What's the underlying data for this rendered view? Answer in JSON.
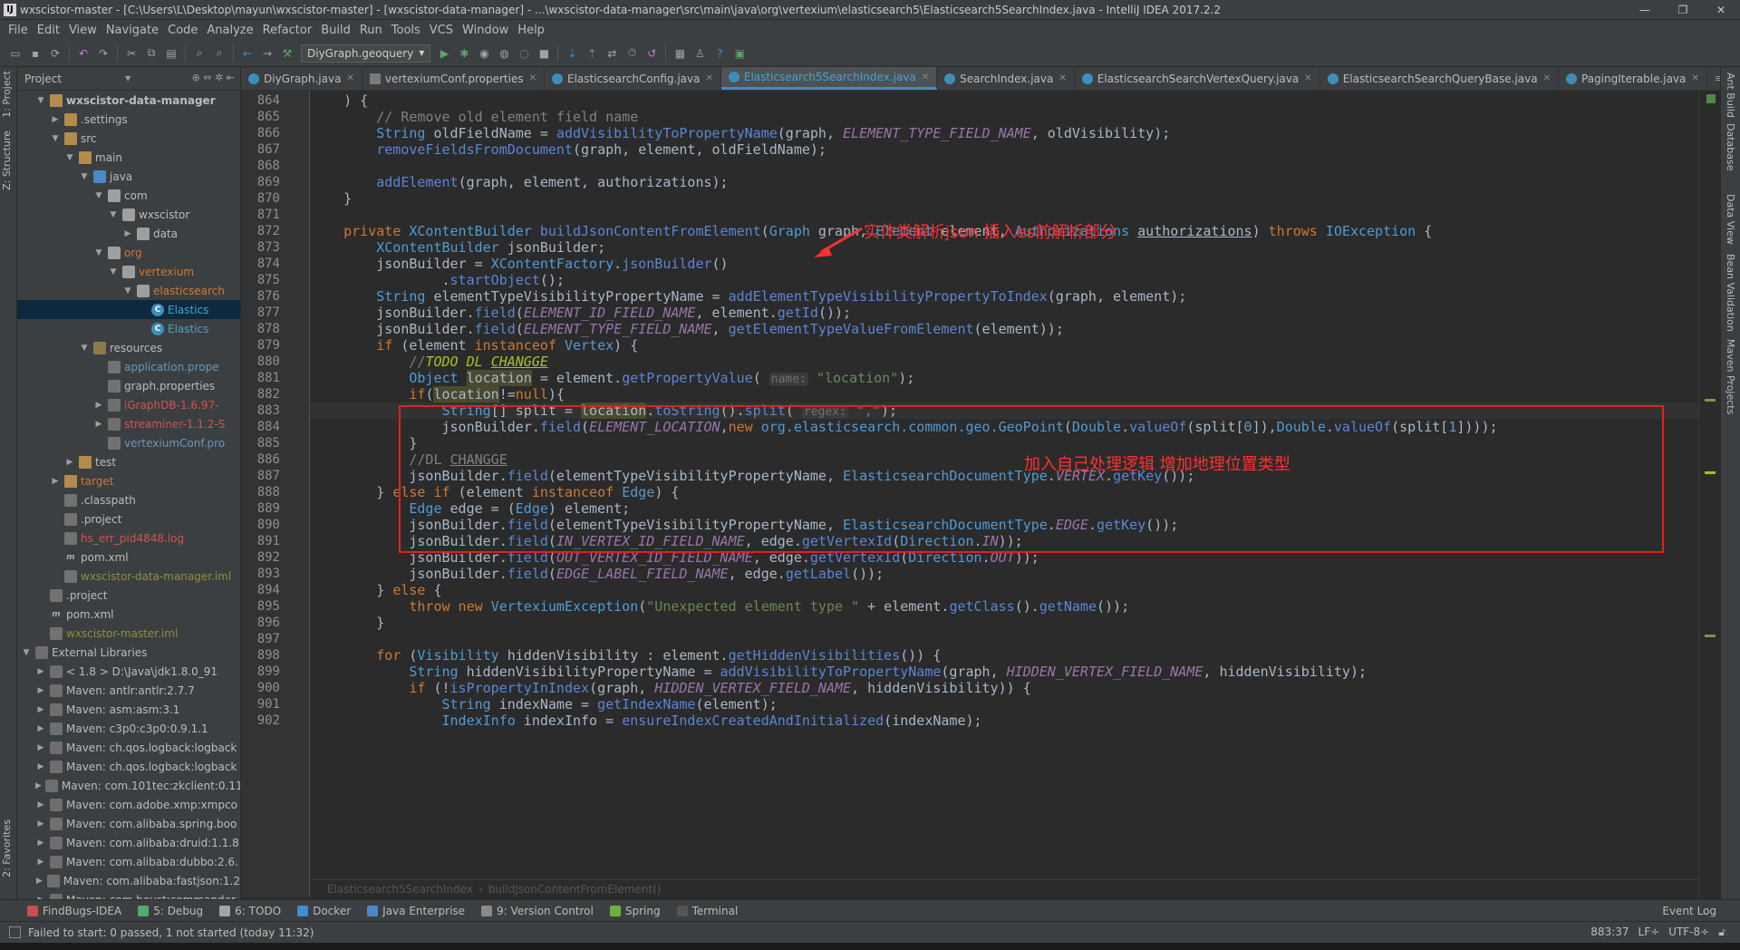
{
  "window": {
    "title": "wxscistor-master - [C:\\Users\\L\\Desktop\\mayun\\wxscistor-master] - [wxscistor-data-manager] - ...\\wxscistor-data-manager\\src\\main\\java\\org\\vertexium\\elasticsearch5\\Elasticsearch5SearchIndex.java - IntelliJ IDEA 2017.2.2",
    "app_icon": "IJ",
    "minimize": "—",
    "maximize": "❐",
    "close": "✕"
  },
  "menu": [
    "File",
    "Edit",
    "View",
    "Navigate",
    "Code",
    "Analyze",
    "Refactor",
    "Build",
    "Run",
    "Tools",
    "VCS",
    "Window",
    "Help"
  ],
  "toolbar": {
    "run_config": "DiyGraph.geoquery"
  },
  "sidebar_left": {
    "project_tab": "1: Project",
    "structure_tab": "Z: Structure",
    "favorites_tab": "2: Favorites"
  },
  "sidebar_right": {
    "tabs": [
      "Ant Build",
      "Database",
      "Data View",
      "Bean Validation",
      "Maven Projects"
    ]
  },
  "project_panel": {
    "title": "Project",
    "tree": [
      {
        "label": "wxscistor-data-manager",
        "indent": 1,
        "arrow": "▼",
        "icon": "folder",
        "style": "bold"
      },
      {
        "label": ".settings",
        "indent": 2,
        "arrow": "▶",
        "icon": "folder"
      },
      {
        "label": "src",
        "indent": 2,
        "arrow": "▼",
        "icon": "folder"
      },
      {
        "label": "main",
        "indent": 3,
        "arrow": "▼",
        "icon": "folder"
      },
      {
        "label": "java",
        "indent": 4,
        "arrow": "▼",
        "icon": "src"
      },
      {
        "label": "com",
        "indent": 5,
        "arrow": "▼",
        "icon": "pkg"
      },
      {
        "label": "wxscistor",
        "indent": 6,
        "arrow": "▼",
        "icon": "pkg"
      },
      {
        "label": "data",
        "indent": 7,
        "arrow": "▶",
        "icon": "pkg"
      },
      {
        "label": "org",
        "indent": 5,
        "arrow": "▼",
        "icon": "pkg",
        "color": "orange"
      },
      {
        "label": "vertexium",
        "indent": 6,
        "arrow": "▼",
        "icon": "pkg",
        "color": "orange"
      },
      {
        "label": "elasticsearch",
        "indent": 7,
        "arrow": "▼",
        "icon": "pkg",
        "color": "orange"
      },
      {
        "label": "Elastics",
        "indent": 8,
        "arrow": "",
        "icon": "class",
        "color": "cyan",
        "selected": true
      },
      {
        "label": "Elastics",
        "indent": 8,
        "arrow": "",
        "icon": "class",
        "color": "cyan"
      },
      {
        "label": "resources",
        "indent": 4,
        "arrow": "▼",
        "icon": "res"
      },
      {
        "label": "application.prope",
        "indent": 5,
        "arrow": "",
        "icon": "file",
        "color": "blue"
      },
      {
        "label": "graph.properties",
        "indent": 5,
        "arrow": "",
        "icon": "file"
      },
      {
        "label": "iGraphDB-1.6.97-",
        "indent": 5,
        "arrow": "▶",
        "icon": "lib",
        "color": "red"
      },
      {
        "label": "streaminer-1.1.2-S",
        "indent": 5,
        "arrow": "▶",
        "icon": "lib",
        "color": "red"
      },
      {
        "label": "vertexiumConf.pro",
        "indent": 5,
        "arrow": "",
        "icon": "file",
        "color": "blue"
      },
      {
        "label": "test",
        "indent": 3,
        "arrow": "▶",
        "icon": "folder"
      },
      {
        "label": "target",
        "indent": 2,
        "arrow": "▶",
        "icon": "folder",
        "color": "orange"
      },
      {
        "label": ".classpath",
        "indent": 2,
        "arrow": "",
        "icon": "file"
      },
      {
        "label": ".project",
        "indent": 2,
        "arrow": "",
        "icon": "file"
      },
      {
        "label": "hs_err_pid4848.log",
        "indent": 2,
        "arrow": "",
        "icon": "file",
        "color": "red"
      },
      {
        "label": "pom.xml",
        "indent": 2,
        "arrow": "",
        "icon": "m"
      },
      {
        "label": "wxscistor-data-manager.iml",
        "indent": 2,
        "arrow": "",
        "icon": "file",
        "color": "olive"
      },
      {
        "label": ".project",
        "indent": 1,
        "arrow": "",
        "icon": "file"
      },
      {
        "label": "pom.xml",
        "indent": 1,
        "arrow": "",
        "icon": "m"
      },
      {
        "label": "wxscistor-master.iml",
        "indent": 1,
        "arrow": "",
        "icon": "file",
        "color": "olive"
      },
      {
        "label": "External Libraries",
        "indent": 0,
        "arrow": "▼",
        "icon": "lib"
      },
      {
        "label": "< 1.8 >  D:\\Java\\jdk1.8.0_91",
        "indent": 1,
        "arrow": "▶",
        "icon": "lib"
      },
      {
        "label": "Maven: antlr:antlr:2.7.7",
        "indent": 1,
        "arrow": "▶",
        "icon": "lib"
      },
      {
        "label": "Maven: asm:asm:3.1",
        "indent": 1,
        "arrow": "▶",
        "icon": "lib"
      },
      {
        "label": "Maven: c3p0:c3p0:0.9.1.1",
        "indent": 1,
        "arrow": "▶",
        "icon": "lib"
      },
      {
        "label": "Maven: ch.qos.logback:logback",
        "indent": 1,
        "arrow": "▶",
        "icon": "lib"
      },
      {
        "label": "Maven: ch.qos.logback:logback",
        "indent": 1,
        "arrow": "▶",
        "icon": "lib"
      },
      {
        "label": "Maven: com.101tec:zkclient:0.11",
        "indent": 1,
        "arrow": "▶",
        "icon": "lib"
      },
      {
        "label": "Maven: com.adobe.xmp:xmpco",
        "indent": 1,
        "arrow": "▶",
        "icon": "lib"
      },
      {
        "label": "Maven: com.alibaba.spring.boo",
        "indent": 1,
        "arrow": "▶",
        "icon": "lib"
      },
      {
        "label": "Maven: com.alibaba:druid:1.1.8",
        "indent": 1,
        "arrow": "▶",
        "icon": "lib"
      },
      {
        "label": "Maven: com.alibaba:dubbo:2.6.",
        "indent": 1,
        "arrow": "▶",
        "icon": "lib"
      },
      {
        "label": "Maven: com.alibaba:fastjson:1.2",
        "indent": 1,
        "arrow": "▶",
        "icon": "lib"
      },
      {
        "label": "Maven: com.beust:commander",
        "indent": 1,
        "arrow": "▶",
        "icon": "lib"
      }
    ]
  },
  "editor_tabs": [
    {
      "label": "DiyGraph.java",
      "kind": "class"
    },
    {
      "label": "vertexiumConf.properties",
      "kind": "file"
    },
    {
      "label": "ElasticsearchConfig.java",
      "kind": "class"
    },
    {
      "label": "Elasticsearch5SearchIndex.java",
      "kind": "class",
      "active": true
    },
    {
      "label": "SearchIndex.java",
      "kind": "class"
    },
    {
      "label": "ElasticsearchSearchVertexQuery.java",
      "kind": "class"
    },
    {
      "label": "ElasticsearchSearchQueryBase.java",
      "kind": "class"
    },
    {
      "label": "PagingIterable.java",
      "kind": "class"
    }
  ],
  "editor_tabs_more": "≡2",
  "code_lines": [
    {
      "n": "864",
      "html": "    ) {"
    },
    {
      "n": "865",
      "html": "        <span class='c'>// Remove old element field name</span>"
    },
    {
      "n": "866",
      "html": "        <span class='cls'>String</span> oldFieldName = <span class='m'>addVisibilityToPropertyName</span>(graph, <span class='f'>ELEMENT_TYPE_FIELD_NAME</span>, oldVisibility);"
    },
    {
      "n": "867",
      "html": "        <span class='m'>removeFieldsFromDocument</span>(graph, element, oldFieldName);"
    },
    {
      "n": "868",
      "html": ""
    },
    {
      "n": "869",
      "html": "        <span class='m'>addElement</span>(graph, element, authorizations);"
    },
    {
      "n": "870",
      "html": "    }"
    },
    {
      "n": "871",
      "html": ""
    },
    {
      "n": "872",
      "html": "    <span class='k'>private</span> <span class='cls'>XContentBuilder</span> <span class='m'>buildJsonContentFromElement</span>(<span class='cls'>Graph</span> graph, <span class='cls'>Element</span> element, <span class='cls'>Authorizations</span> <u>authorizations</u>) <span class='k'>throws</span> <span class='cls'>IOException</span> {"
    },
    {
      "n": "873",
      "html": "        <span class='cls'>XContentBuilder</span> jsonBuilder;"
    },
    {
      "n": "874",
      "html": "        jsonBuilder = <span class='cls'>XContentFactory</span>.<span class='m'>jsonBuilder</span>()"
    },
    {
      "n": "875",
      "html": "                .<span class='m'>startObject</span>();"
    },
    {
      "n": "876",
      "html": "        <span class='cls'>String</span> elementTypeVisibilityPropertyName = <span class='m'>addElementTypeVisibilityPropertyToIndex</span>(graph, element);"
    },
    {
      "n": "877",
      "html": "        jsonBuilder.<span class='m'>field</span>(<span class='f'>ELEMENT_ID_FIELD_NAME</span>, element.<span class='m'>getId</span>());"
    },
    {
      "n": "878",
      "html": "        jsonBuilder.<span class='m'>field</span>(<span class='f'>ELEMENT_TYPE_FIELD_NAME</span>, <span class='m'>getElementTypeValueFromElement</span>(element));"
    },
    {
      "n": "879",
      "html": "        <span class='k'>if</span> (element <span class='k'>instanceof</span> <span class='cls'>Vertex</span>) {"
    },
    {
      "n": "880",
      "html": "            <span class='c'>//</span><span class='todo'>TODO DL <u>CHANGGE</u></span>"
    },
    {
      "n": "881",
      "html": "            <span class='cls'>Object</span> <span class='hl'>location</span> = element.<span class='m'>getPropertyValue</span>( <span class='hint'>name:</span> <span class='s'>\"location\"</span>);"
    },
    {
      "n": "882",
      "html": "            <span class='k'>if</span>(<span class='hl'>location</span>!=<span class='k'>null</span>){"
    },
    {
      "n": "883",
      "html": "                <span class='cls'>String</span>[] split = <span class='hl'>location</span>.<span class='m'>toString</span>().<span class='m'>split</span>( <span class='hint'>regex:</span> <span class='s'>\",\"</span>);",
      "caret": true
    },
    {
      "n": "884",
      "html": "                jsonBuilder.<span class='m'>field</span>(<span class='f'>ELEMENT_LOCATION</span>,<span class='k'>new</span> <span class='cls'>org.elasticsearch.common.geo.GeoPoint</span>(<span class='cls'>Double</span>.<span class='m'>valueOf</span>(split[<span class='n'>0</span>]),<span class='cls'>Double</span>.<span class='m'>valueOf</span>(split[<span class='n'>1</span>])));"
    },
    {
      "n": "885",
      "html": "            }"
    },
    {
      "n": "886",
      "html": "            <span class='c'>//DL <u>CHANGGE</u></span>"
    },
    {
      "n": "887",
      "html": "            jsonBuilder.<span class='m'>field</span>(elementTypeVisibilityPropertyName, <span class='cls'>ElasticsearchDocumentType</span>.<span class='f'>VERTEX</span>.<span class='m'>getKey</span>());"
    },
    {
      "n": "888",
      "html": "        } <span class='k'>else if</span> (element <span class='k'>instanceof</span> <span class='cls'>Edge</span>) {"
    },
    {
      "n": "889",
      "html": "            <span class='cls'>Edge</span> edge = (<span class='cls'>Edge</span>) element;"
    },
    {
      "n": "890",
      "html": "            jsonBuilder.<span class='m'>field</span>(elementTypeVisibilityPropertyName, <span class='cls'>ElasticsearchDocumentType</span>.<span class='f'>EDGE</span>.<span class='m'>getKey</span>());"
    },
    {
      "n": "891",
      "html": "            jsonBuilder.<span class='m'>field</span>(<span class='f'>IN_VERTEX_ID_FIELD_NAME</span>, edge.<span class='m'>getVertexId</span>(<span class='cls'>Direction</span>.<span class='f'>IN</span>));"
    },
    {
      "n": "892",
      "html": "            jsonBuilder.<span class='m'>field</span>(<span class='f'>OUT_VERTEX_ID_FIELD_NAME</span>, edge.<span class='m'>getVertexId</span>(<span class='cls'>Direction</span>.<span class='f'>OUT</span>));"
    },
    {
      "n": "893",
      "html": "            jsonBuilder.<span class='m'>field</span>(<span class='f'>EDGE_LABEL_FIELD_NAME</span>, edge.<span class='m'>getLabel</span>());"
    },
    {
      "n": "894",
      "html": "        } <span class='k'>else</span> {"
    },
    {
      "n": "895",
      "html": "            <span class='k'>throw new</span> <span class='cls'>VertexiumException</span>(<span class='s'>\"Unexpected element type \"</span> + element.<span class='m'>getClass</span>().<span class='m'>getName</span>());"
    },
    {
      "n": "896",
      "html": "        }"
    },
    {
      "n": "897",
      "html": ""
    },
    {
      "n": "898",
      "html": "        <span class='k'>for</span> (<span class='cls'>Visibility</span> hiddenVisibility : element.<span class='m'>getHiddenVisibilities</span>()) {"
    },
    {
      "n": "899",
      "html": "            <span class='cls'>String</span> hiddenVisibilityPropertyName = <span class='m'>addVisibilityToPropertyName</span>(graph, <span class='f'>HIDDEN_VERTEX_FIELD_NAME</span>, hiddenVisibility);"
    },
    {
      "n": "900",
      "html": "            <span class='k'>if</span> (!<span class='m'>isPropertyInIndex</span>(graph, <span class='f'>HIDDEN_VERTEX_FIELD_NAME</span>, hiddenVisibility)) {"
    },
    {
      "n": "901",
      "html": "                <span class='cls'>String</span> indexName = <span class='m'>getIndexName</span>(element);"
    },
    {
      "n": "902",
      "html": "                <span class='cls'>IndexInfo</span> indexInfo = <span class='m'>ensureIndexCreatedAndInitialized</span>(indexName);"
    }
  ],
  "annotations": {
    "arrow_note": "实体类解析json 插入es前解析部分",
    "box_note": "加入自己处理逻辑  增加地理位置类型"
  },
  "breadcrumb": {
    "class": "Elasticsearch5SearchIndex",
    "method": "buildJsonContentFromElement()"
  },
  "bottom_tools": [
    {
      "label": "FindBugs-IDEA",
      "color": "#c94f4f"
    },
    {
      "label": "5: Debug",
      "color": "#59a869"
    },
    {
      "label": "6: TODO",
      "color": "#9aa7b0"
    },
    {
      "label": "Docker",
      "color": "#3e8ed0"
    },
    {
      "label": "Java Enterprise",
      "color": "#4a88c7"
    },
    {
      "label": "9: Version Control",
      "color": "#8a8a8a"
    },
    {
      "label": "Spring",
      "color": "#6cb33e"
    },
    {
      "label": "Terminal",
      "color": "#555555"
    }
  ],
  "event_log": "Event Log",
  "status": {
    "message": "Failed to start: 0 passed, 1 not started (today 11:32)",
    "position": "883:37",
    "line_sep": "LF÷",
    "encoding": "UTF-8÷"
  }
}
